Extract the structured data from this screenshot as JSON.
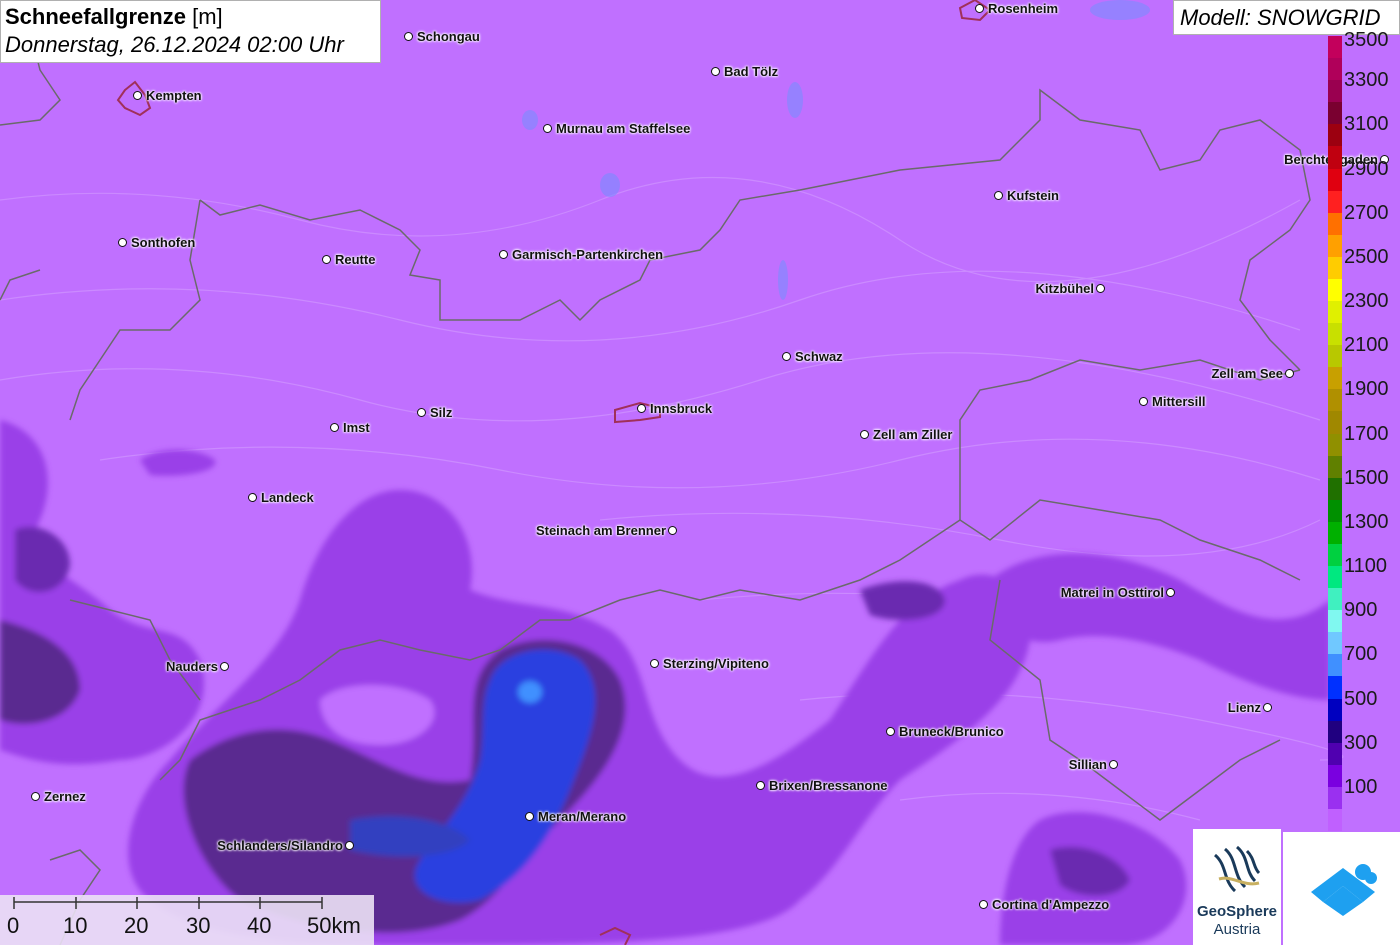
{
  "title": {
    "main": "Schneefallgrenze",
    "unit": "[m]",
    "datetime": "Donnerstag, 26.12.2024 02:00 Uhr"
  },
  "model": "Modell: SNOWGRID",
  "legend": {
    "labels": [
      "3500",
      "3300",
      "3100",
      "2900",
      "2700",
      "2500",
      "2300",
      "2100",
      "1900",
      "1700",
      "1500",
      "1300",
      "1100",
      "900",
      "700",
      "500",
      "300",
      "100"
    ],
    "colors": [
      "#c3005c",
      "#b0005a",
      "#9a0050",
      "#7a0030",
      "#9c0010",
      "#c00010",
      "#e00010",
      "#ff2020",
      "#ff7000",
      "#ffa000",
      "#ffcc00",
      "#ffff00",
      "#e0f000",
      "#c8e000",
      "#b8c800",
      "#c8a000",
      "#b09000",
      "#a08800",
      "#909000",
      "#608000",
      "#207000",
      "#009000",
      "#00b000",
      "#00d040",
      "#00e880",
      "#40f0c0",
      "#80f8f0",
      "#70c8ff",
      "#4090ff",
      "#0030ff",
      "#0000c0",
      "#200080",
      "#5000b0",
      "#7a00e0",
      "#9a30f0",
      "#c060ff"
    ]
  },
  "colors": {
    "base": "#c070ff",
    "mid": "#9a40e8",
    "dark": "#7a2ac8",
    "deep": "#4a2080",
    "blue": "#2a40e0",
    "lightblue": "#4090ff"
  },
  "scale": {
    "labels": [
      "0",
      "10",
      "20",
      "30",
      "40",
      "50km"
    ]
  },
  "logos": {
    "geo_name": "GeoSphere",
    "geo_sub": "Austria",
    "geo_icon": "geosphere-logo-icon",
    "acin_icon": "cloud-mountain-logo-icon"
  },
  "cities": [
    {
      "name": "Rosenheim",
      "label_side": "right"
    },
    {
      "name": "Schongau",
      "label_side": "right"
    },
    {
      "name": "Kempten",
      "label_side": "right"
    },
    {
      "name": "Bad Tölz",
      "label_side": "right"
    },
    {
      "name": "Murnau am Staffelsee",
      "label_side": "right"
    },
    {
      "name": "Berchtesgaden",
      "label_side": "left"
    },
    {
      "name": "Kufstein",
      "label_side": "right"
    },
    {
      "name": "Sonthofen",
      "label_side": "right"
    },
    {
      "name": "Reutte",
      "label_side": "right"
    },
    {
      "name": "Garmisch-Partenkirchen",
      "label_side": "right"
    },
    {
      "name": "Kitzbühel",
      "label_side": "left"
    },
    {
      "name": "Schwaz",
      "label_side": "right"
    },
    {
      "name": "Zell am See",
      "label_side": "left"
    },
    {
      "name": "Mittersill",
      "label_side": "right"
    },
    {
      "name": "Innsbruck",
      "label_side": "right"
    },
    {
      "name": "Silz",
      "label_side": "right"
    },
    {
      "name": "Imst",
      "label_side": "right"
    },
    {
      "name": "Zell am Ziller",
      "label_side": "right"
    },
    {
      "name": "Landeck",
      "label_side": "right"
    },
    {
      "name": "Steinach am Brenner",
      "label_side": "left"
    },
    {
      "name": "Matrei in Osttirol",
      "label_side": "left"
    },
    {
      "name": "Nauders",
      "label_side": "left"
    },
    {
      "name": "Sterzing/Vipiteno",
      "label_side": "right"
    },
    {
      "name": "Lienz",
      "label_side": "left"
    },
    {
      "name": "Bruneck/Brunico",
      "label_side": "right"
    },
    {
      "name": "Sillian",
      "label_side": "left"
    },
    {
      "name": "Zernez",
      "label_side": "right"
    },
    {
      "name": "Brixen/Bressanone",
      "label_side": "right"
    },
    {
      "name": "Meran/Merano",
      "label_side": "right"
    },
    {
      "name": "Schlanders/Silandro",
      "label_side": "left"
    },
    {
      "name": "Cortina d'Ampezzo",
      "label_side": "right"
    }
  ]
}
